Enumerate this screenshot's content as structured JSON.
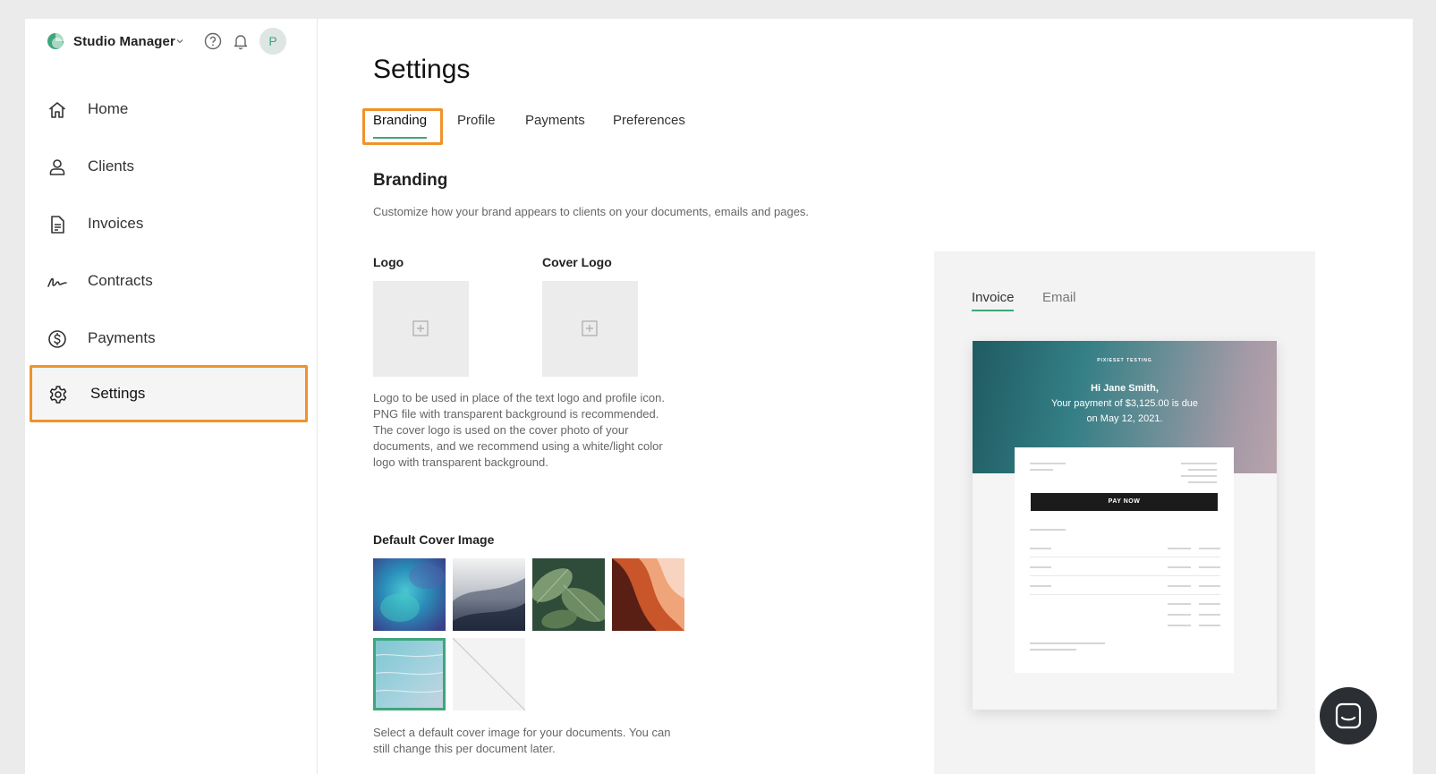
{
  "app": {
    "name": "Studio Manager",
    "avatar_initial": "P"
  },
  "sidebar": {
    "items": [
      {
        "label": "Home",
        "icon": "home-icon"
      },
      {
        "label": "Clients",
        "icon": "user-icon"
      },
      {
        "label": "Invoices",
        "icon": "document-icon"
      },
      {
        "label": "Contracts",
        "icon": "signature-icon"
      },
      {
        "label": "Payments",
        "icon": "dollar-circle-icon"
      },
      {
        "label": "Settings",
        "icon": "gear-icon",
        "active": true
      }
    ]
  },
  "page": {
    "title": "Settings",
    "tabs": [
      {
        "label": "Branding",
        "active": true
      },
      {
        "label": "Profile"
      },
      {
        "label": "Payments"
      },
      {
        "label": "Preferences"
      }
    ]
  },
  "branding": {
    "title": "Branding",
    "description": "Customize how your brand appears to clients on your documents, emails and pages.",
    "logo_label": "Logo",
    "cover_logo_label": "Cover Logo",
    "logo_help": [
      "Logo to be used in place of the text logo and profile icon.",
      "PNG file with transparent background is recommended.",
      "The cover logo is used on the cover photo of your",
      "documents, and we recommend using a white/light color",
      "logo with transparent background."
    ],
    "cover_image_label": "Default Cover Image",
    "cover_images": [
      {
        "name": "blue-blur"
      },
      {
        "name": "sand-dunes"
      },
      {
        "name": "green-leaves"
      },
      {
        "name": "orange-canyon"
      },
      {
        "name": "ocean-sand",
        "selected": true
      },
      {
        "name": "none"
      }
    ],
    "cover_help": [
      "Select a default cover image for your documents. You can",
      "still change this per document later."
    ]
  },
  "preview": {
    "tabs": [
      {
        "label": "Invoice",
        "active": true
      },
      {
        "label": "Email"
      }
    ],
    "tiny_header": "PIXIESET TESTING",
    "greeting": "Hi Jane Smith,",
    "message_line1": "Your payment of $3,125.00 is due",
    "message_line2": "on May 12, 2021.",
    "pay_button": "PAY NOW"
  },
  "colors": {
    "accent": "#3fa67c",
    "highlight": "#f0922a"
  }
}
